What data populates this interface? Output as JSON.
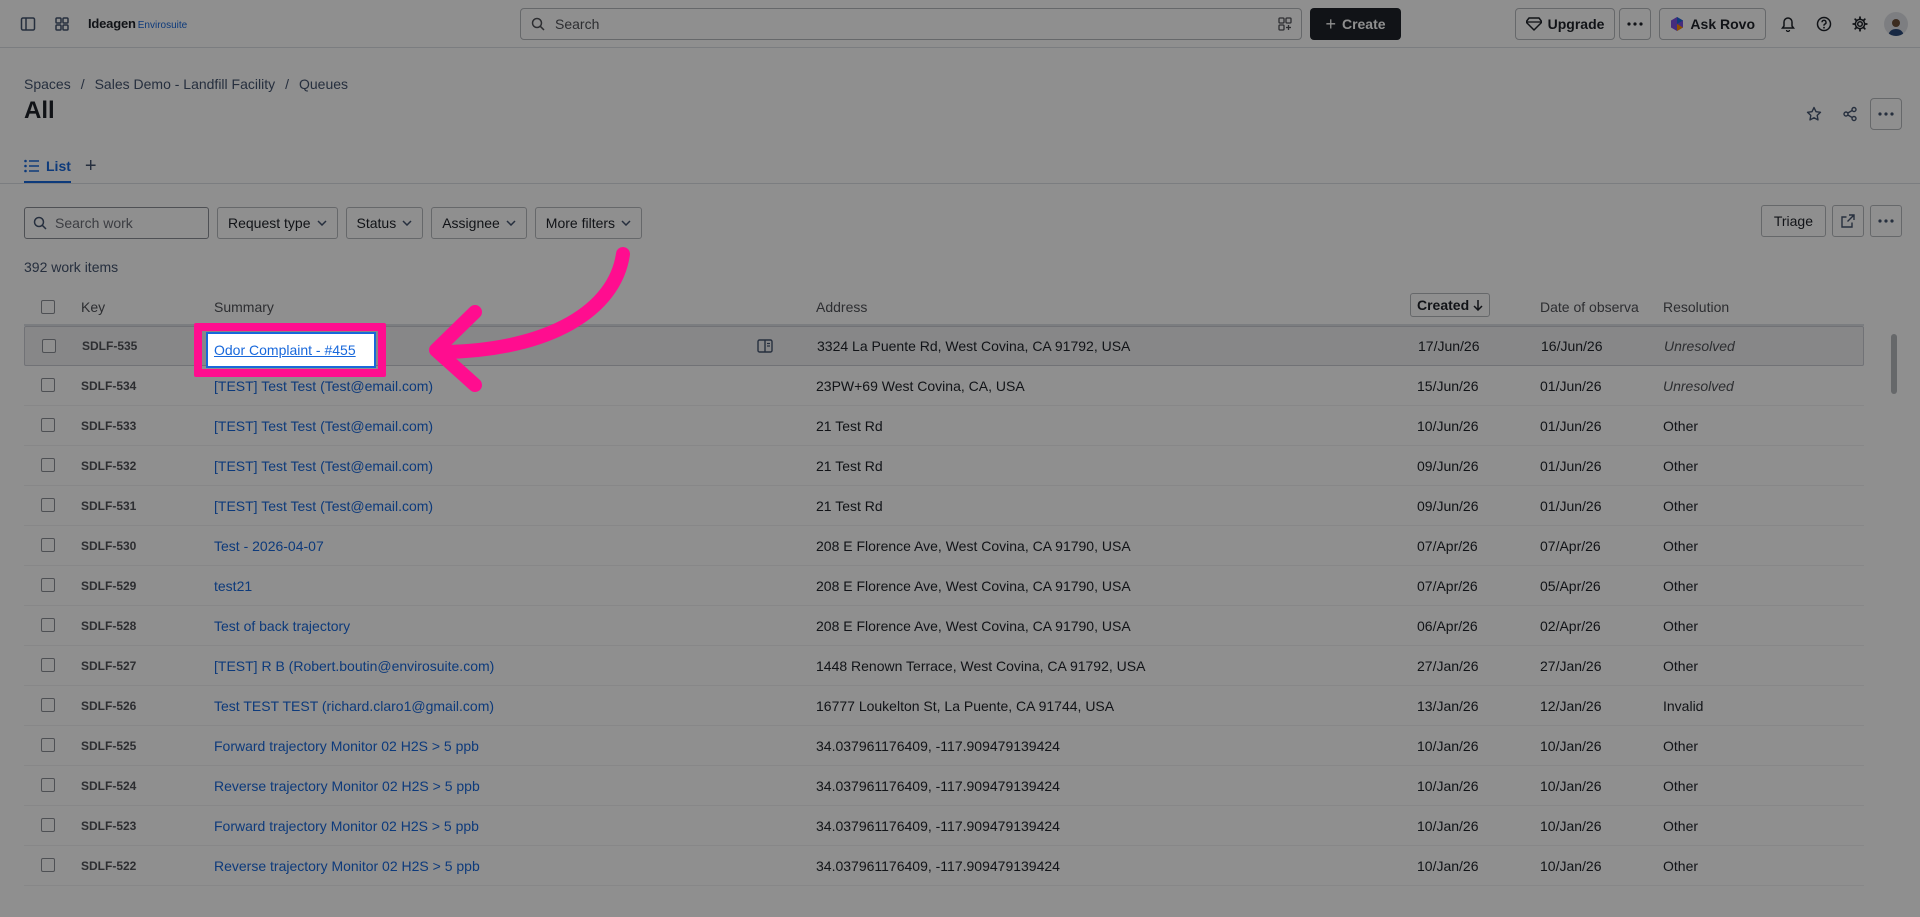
{
  "topbar": {
    "logo_brand": "Ideagen",
    "logo_product": "Envirosuite",
    "search_placeholder": "Search",
    "create_label": "Create",
    "upgrade_label": "Upgrade",
    "ask_rovo_label": "Ask Rovo"
  },
  "breadcrumb": [
    "Spaces",
    "Sales Demo - Landfill Facility",
    "Queues"
  ],
  "page_title": "All",
  "tabs": {
    "list_label": "List"
  },
  "filters": {
    "search_placeholder": "Search work",
    "request_type": "Request type",
    "status": "Status",
    "assignee": "Assignee",
    "more_filters": "More filters",
    "triage": "Triage"
  },
  "count_text": "392 work items",
  "table": {
    "headers": {
      "key": "Key",
      "summary": "Summary",
      "address": "Address",
      "created": "Created",
      "date_of_observation": "Date of observa",
      "resolution": "Resolution"
    },
    "rows": [
      {
        "key": "SDLF-535",
        "summary": "Odor Complaint - #455",
        "address": "3324 La Puente Rd, West Covina, CA 91792, USA",
        "created": "17/Jun/26",
        "observed": "16/Jun/26",
        "resolution": "Unresolved"
      },
      {
        "key": "SDLF-534",
        "summary": "[TEST] Test Test (Test@email.com)",
        "address": "23PW+69 West Covina, CA, USA",
        "created": "15/Jun/26",
        "observed": "01/Jun/26",
        "resolution": "Unresolved"
      },
      {
        "key": "SDLF-533",
        "summary": "[TEST] Test Test (Test@email.com)",
        "address": "21 Test Rd",
        "created": "10/Jun/26",
        "observed": "01/Jun/26",
        "resolution": "Other"
      },
      {
        "key": "SDLF-532",
        "summary": "[TEST] Test Test (Test@email.com)",
        "address": "21 Test Rd",
        "created": "09/Jun/26",
        "observed": "01/Jun/26",
        "resolution": "Other"
      },
      {
        "key": "SDLF-531",
        "summary": "[TEST] Test Test (Test@email.com)",
        "address": "21 Test Rd",
        "created": "09/Jun/26",
        "observed": "01/Jun/26",
        "resolution": "Other"
      },
      {
        "key": "SDLF-530",
        "summary": "Test - 2026-04-07",
        "address": "208 E Florence Ave, West Covina, CA 91790, USA",
        "created": "07/Apr/26",
        "observed": "07/Apr/26",
        "resolution": "Other"
      },
      {
        "key": "SDLF-529",
        "summary": "test21",
        "address": "208 E Florence Ave, West Covina, CA 91790, USA",
        "created": "07/Apr/26",
        "observed": "05/Apr/26",
        "resolution": "Other"
      },
      {
        "key": "SDLF-528",
        "summary": "Test of back trajectory",
        "address": "208 E Florence Ave, West Covina, CA 91790, USA",
        "created": "06/Apr/26",
        "observed": "02/Apr/26",
        "resolution": "Other"
      },
      {
        "key": "SDLF-527",
        "summary": "[TEST] R B (Robert.boutin@envirosuite.com)",
        "address": "1448 Renown Terrace, West Covina, CA 91792, USA",
        "created": "27/Jan/26",
        "observed": "27/Jan/26",
        "resolution": "Other"
      },
      {
        "key": "SDLF-526",
        "summary": "Test TEST TEST (richard.claro1@gmail.com)",
        "address": "16777 Loukelton St, La Puente, CA 91744, USA",
        "created": "13/Jan/26",
        "observed": "12/Jan/26",
        "resolution": "Invalid"
      },
      {
        "key": "SDLF-525",
        "summary": "Forward trajectory Monitor 02 H2S > 5 ppb",
        "address": "34.037961176409, -117.909479139424",
        "created": "10/Jan/26",
        "observed": "10/Jan/26",
        "resolution": "Other"
      },
      {
        "key": "SDLF-524",
        "summary": "Reverse trajectory Monitor 02 H2S > 5 ppb",
        "address": "34.037961176409, -117.909479139424",
        "created": "10/Jan/26",
        "observed": "10/Jan/26",
        "resolution": "Other"
      },
      {
        "key": "SDLF-523",
        "summary": "Forward trajectory Monitor 02 H2S > 5 ppb",
        "address": "34.037961176409, -117.909479139424",
        "created": "10/Jan/26",
        "observed": "10/Jan/26",
        "resolution": "Other"
      },
      {
        "key": "SDLF-522",
        "summary": "Reverse trajectory Monitor 02 H2S > 5 ppb",
        "address": "34.037961176409, -117.909479139424",
        "created": "10/Jan/26",
        "observed": "10/Jan/26",
        "resolution": "Other"
      }
    ]
  },
  "colors": {
    "accent": "#1868db",
    "highlight": "#ff0d8f",
    "overlay": "rgba(0,0,0,0.44)"
  }
}
